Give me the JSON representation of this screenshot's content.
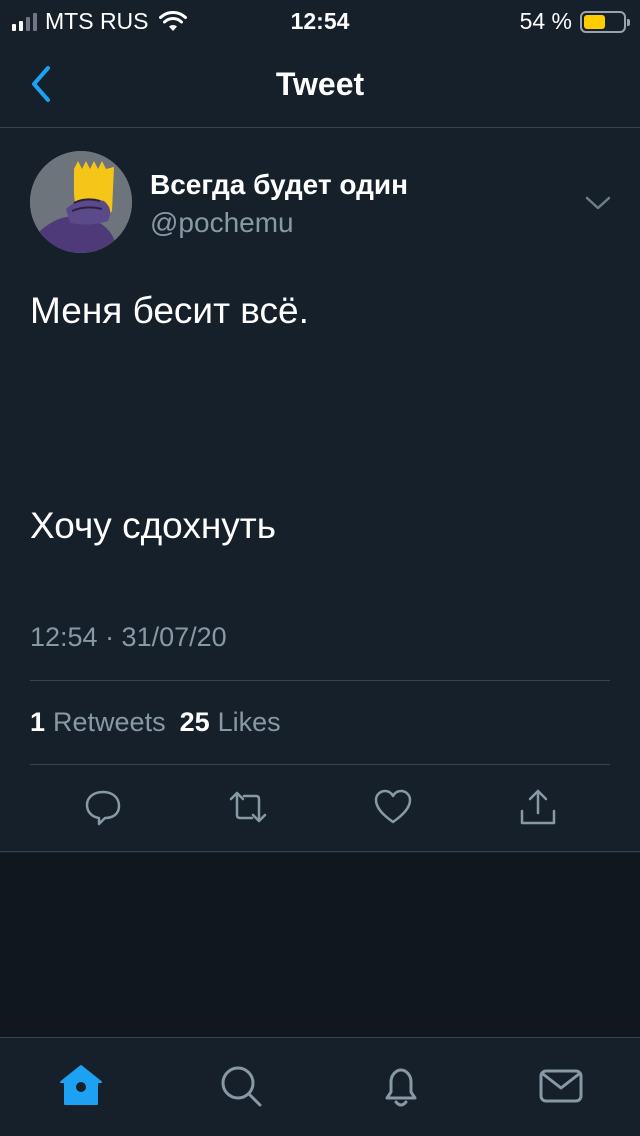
{
  "status_bar": {
    "carrier": "MTS RUS",
    "time": "12:54",
    "battery_percent": "54 %",
    "battery_level": 0.54
  },
  "nav": {
    "title": "Tweet",
    "back_icon": "chevron-left-icon"
  },
  "tweet": {
    "display_name": "Всегда будет один",
    "handle": "@pochemu",
    "text": "Меня бесит всё.\n\n\n\n\nХочу сдохнуть",
    "meta": "12:54 · 31/07/20",
    "retweets_count": "1",
    "retweets_label": "Retweets",
    "likes_count": "25",
    "likes_label": "Likes"
  },
  "actions": [
    "reply-icon",
    "retweet-icon",
    "like-icon",
    "share-icon"
  ],
  "tabs": [
    "home-icon",
    "search-icon",
    "notifications-icon",
    "messages-icon"
  ],
  "colors": {
    "background": "#15202b",
    "accent": "#1da1f2",
    "secondary_text": "#8899a6",
    "divider": "#38444d"
  }
}
